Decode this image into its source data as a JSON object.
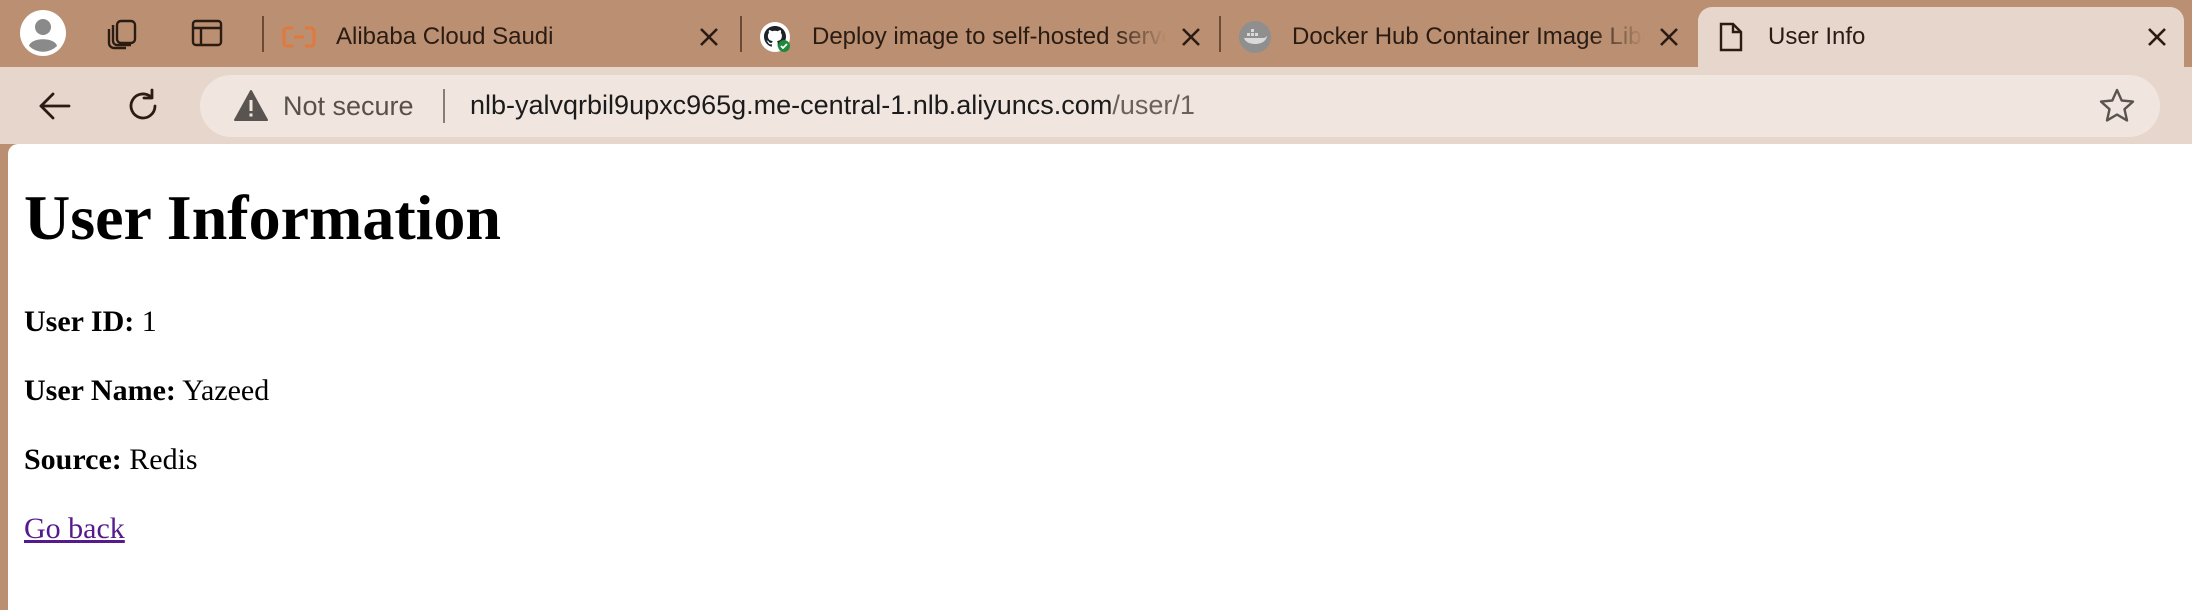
{
  "browser": {
    "tabs": [
      {
        "title": "Alibaba Cloud Saudi",
        "icon": "alibaba-cloud-icon",
        "active": false
      },
      {
        "title": "Deploy image to self-hosted server",
        "icon": "github-icon",
        "active": false
      },
      {
        "title": "Docker Hub Container Image Library",
        "icon": "docker-icon",
        "active": false
      },
      {
        "title": "User Info",
        "icon": "document-icon",
        "active": true
      }
    ],
    "address_bar": {
      "security_label": "Not secure",
      "url_host": "nlb-yalvqrbil9upxc965g.me-central-1.nlb.aliyuncs.com",
      "url_path": "/user/1"
    }
  },
  "page": {
    "heading": "User Information",
    "fields": [
      {
        "label": "User ID:",
        "value": "1"
      },
      {
        "label": "User Name:",
        "value": "Yazeed"
      },
      {
        "label": "Source:",
        "value": "Redis"
      }
    ],
    "back_link": "Go back"
  },
  "colors": {
    "tabstrip_bg": "#bb8f71",
    "toolbar_bg": "#e6d6cb",
    "link_visited": "#551a8b"
  }
}
